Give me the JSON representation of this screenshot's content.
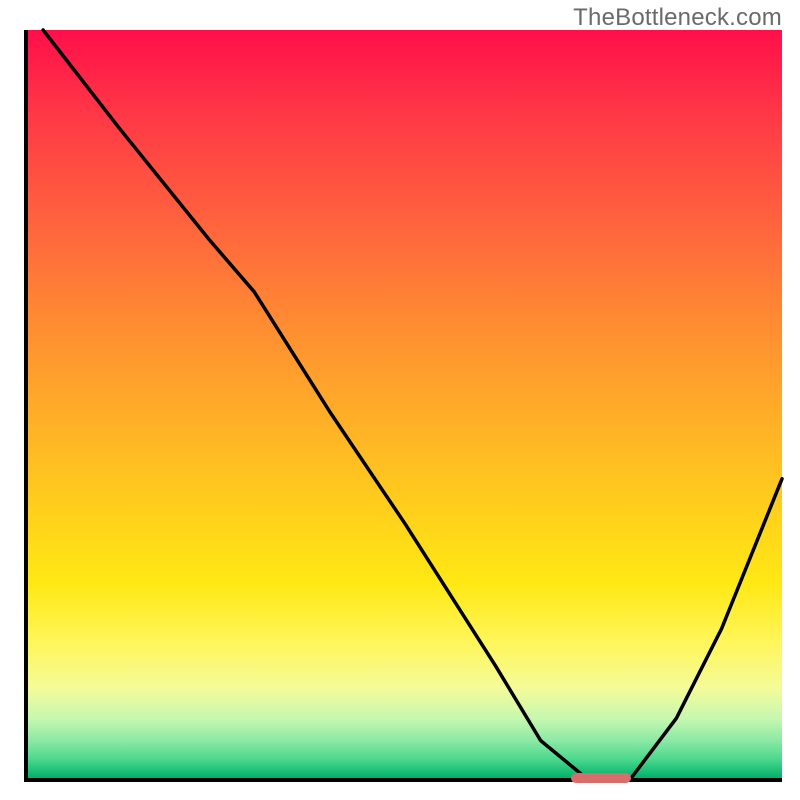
{
  "watermark": "TheBottleneck.com",
  "chart_data": {
    "type": "line",
    "title": "",
    "xlabel": "",
    "ylabel": "",
    "xlim": [
      0,
      100
    ],
    "ylim": [
      0,
      100
    ],
    "grid": false,
    "legend": false,
    "series": [
      {
        "name": "bottleneck-curve",
        "x": [
          2,
          12,
          24,
          30,
          40,
          50,
          62,
          68,
          74,
          80,
          86,
          92,
          100
        ],
        "values": [
          100,
          87,
          72,
          65,
          49,
          34,
          15,
          5,
          0,
          0,
          8,
          20,
          40
        ]
      }
    ],
    "trough_marker": {
      "x_start": 72,
      "x_end": 80,
      "y": 0
    },
    "gradient_scale": {
      "top_color": "#ff0f4a",
      "bottom_color": "#00b16a"
    }
  }
}
